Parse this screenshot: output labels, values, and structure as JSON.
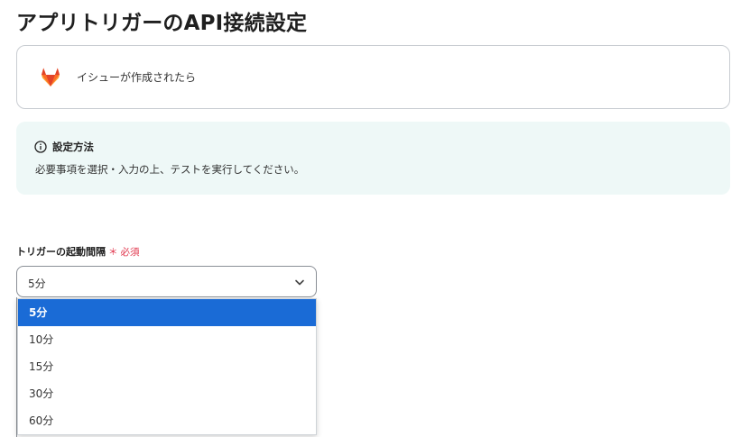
{
  "page": {
    "title": "アプリトリガーのAPI接続設定"
  },
  "app_card": {
    "logo_icon": "gitlab-logo-icon",
    "trigger_label": "イシューが作成されたら"
  },
  "info": {
    "icon": "info-circle-icon",
    "title": "設定方法",
    "body": "必要事項を選択・入力の上、テストを実行してください。"
  },
  "interval_field": {
    "label": "トリガーの起動間隔",
    "required_mark": "＊",
    "required_text": "必須",
    "selected_value": "5分",
    "options": [
      {
        "label": "5分",
        "selected": true
      },
      {
        "label": "10分",
        "selected": false
      },
      {
        "label": "15分",
        "selected": false
      },
      {
        "label": "30分",
        "selected": false
      },
      {
        "label": "60分",
        "selected": false
      }
    ]
  },
  "colors": {
    "accent": "#1a6bd6",
    "required": "#e0334a",
    "info_bg": "#eef8f7",
    "gitlab_orange": "#e24329"
  }
}
